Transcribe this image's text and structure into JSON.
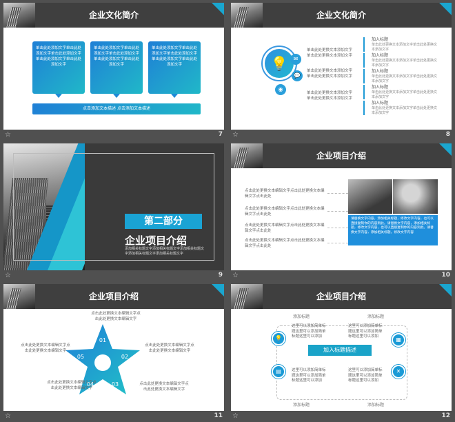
{
  "slides": [
    {
      "number": "7",
      "title": "企业文化简介",
      "boxes": [
        "单击此处添加文字单击此处添加文字单击此处添加文字单击此处添加文字单击此处添加文字",
        "单击此处添加文字单击此处添加文字单击此处添加文字单击此处添加文字单击此处添加文字",
        "单击此处添加文字单击此处添加文字单击此处添加文字单击此处添加文字单击此处添加文字"
      ],
      "bar_text": "点击添加文本描述  点击添加文本描述"
    },
    {
      "number": "8",
      "title": "企业文化简介",
      "icon_descs": [
        "单击此处更换文本添加文字单击此处更换文本添加文字",
        "单击此处更换文本添加文字单击此处更换文本添加文字",
        "单击此处更换文本添加文字单击此处更换文本添加文字"
      ],
      "items": [
        {
          "title": "加入标题",
          "sub": "单击此处更换文本添加文字单击此处更换文本添加文字"
        },
        {
          "title": "加入标题",
          "sub": "单击此处更换文本添加文字单击此处更换文本添加文字"
        },
        {
          "title": "加入标题",
          "sub": "单击此处更换文本添加文字单击此处更换文本添加文字"
        },
        {
          "title": "加入标题",
          "sub": "单击此处更换文本添加文字单击此处更换文本添加文字"
        },
        {
          "title": "加入标题",
          "sub": "单击此处更换文本添加文字单击此处更换文本添加文字"
        }
      ]
    },
    {
      "number": "9",
      "part": "第二部分",
      "title": "企业项目介绍",
      "sub": "添加相关标题文字添加相关标题文字添加相关标题文字添加相关标题文字添加相关标题文字"
    },
    {
      "number": "10",
      "title": "企业项目介绍",
      "lines": [
        "点击此处更换文本编辑文字点击此处更换文本编辑文字点击此处",
        "点击此处更换文本编辑文字点击此处更换文本编辑文字点击此处",
        "点击此处更换文本编辑文字点击此处更换文本编辑文字点击此处",
        "点击此处更换文本编辑文字点击此处更换文本编辑文字点击此处"
      ],
      "box_text": "请替换文字内容，添加相关标题，修改文字内容，也可以直接复制你的内容到此。请替换文字内容，添加相关标题，修改文字内容，也可以直接复制你的内容到此。请替换文字内容，添加相关标题，修改文字内容"
    },
    {
      "number": "11",
      "title": "企业项目介绍",
      "petals": [
        "01",
        "02",
        "03",
        "04",
        "05"
      ],
      "labels": [
        "点击此处更换文本编辑文字点击此处更换文本编辑文字",
        "点击此处更换文本编辑文字点击此处更换文本编辑文字",
        "点击此处更换文本编辑文字点击此处更换文本编辑文字",
        "点击此处更换文本编辑文字点击此处更换文本编辑文字",
        "点击此处更换文本编辑文字点击此处更换文本编辑文字"
      ]
    },
    {
      "number": "12",
      "title": "企业项目介绍",
      "center": "加入标题描述",
      "labels": [
        "添加标题",
        "添加标题",
        "添加标题",
        "添加标题"
      ],
      "descs": [
        "这里可以添加简单标题这里可以添加简单标题这里可以添加",
        "这里可以添加简单标题这里可以添加简单标题这里可以添加",
        "这里可以添加简单标题这里可以添加简单标题这里可以添加",
        "这里可以添加简单标题这里可以添加简单标题这里可以添加"
      ]
    }
  ],
  "icons": {
    "footer": "star-icon",
    "bulb": "lightbulb-icon",
    "mail": "mail-icon",
    "chat": "chat-icon",
    "camera": "camera-icon"
  },
  "colors": {
    "accent": "#1aa3d4",
    "accent2": "#20b8c8",
    "header": "#3f3f3f"
  }
}
